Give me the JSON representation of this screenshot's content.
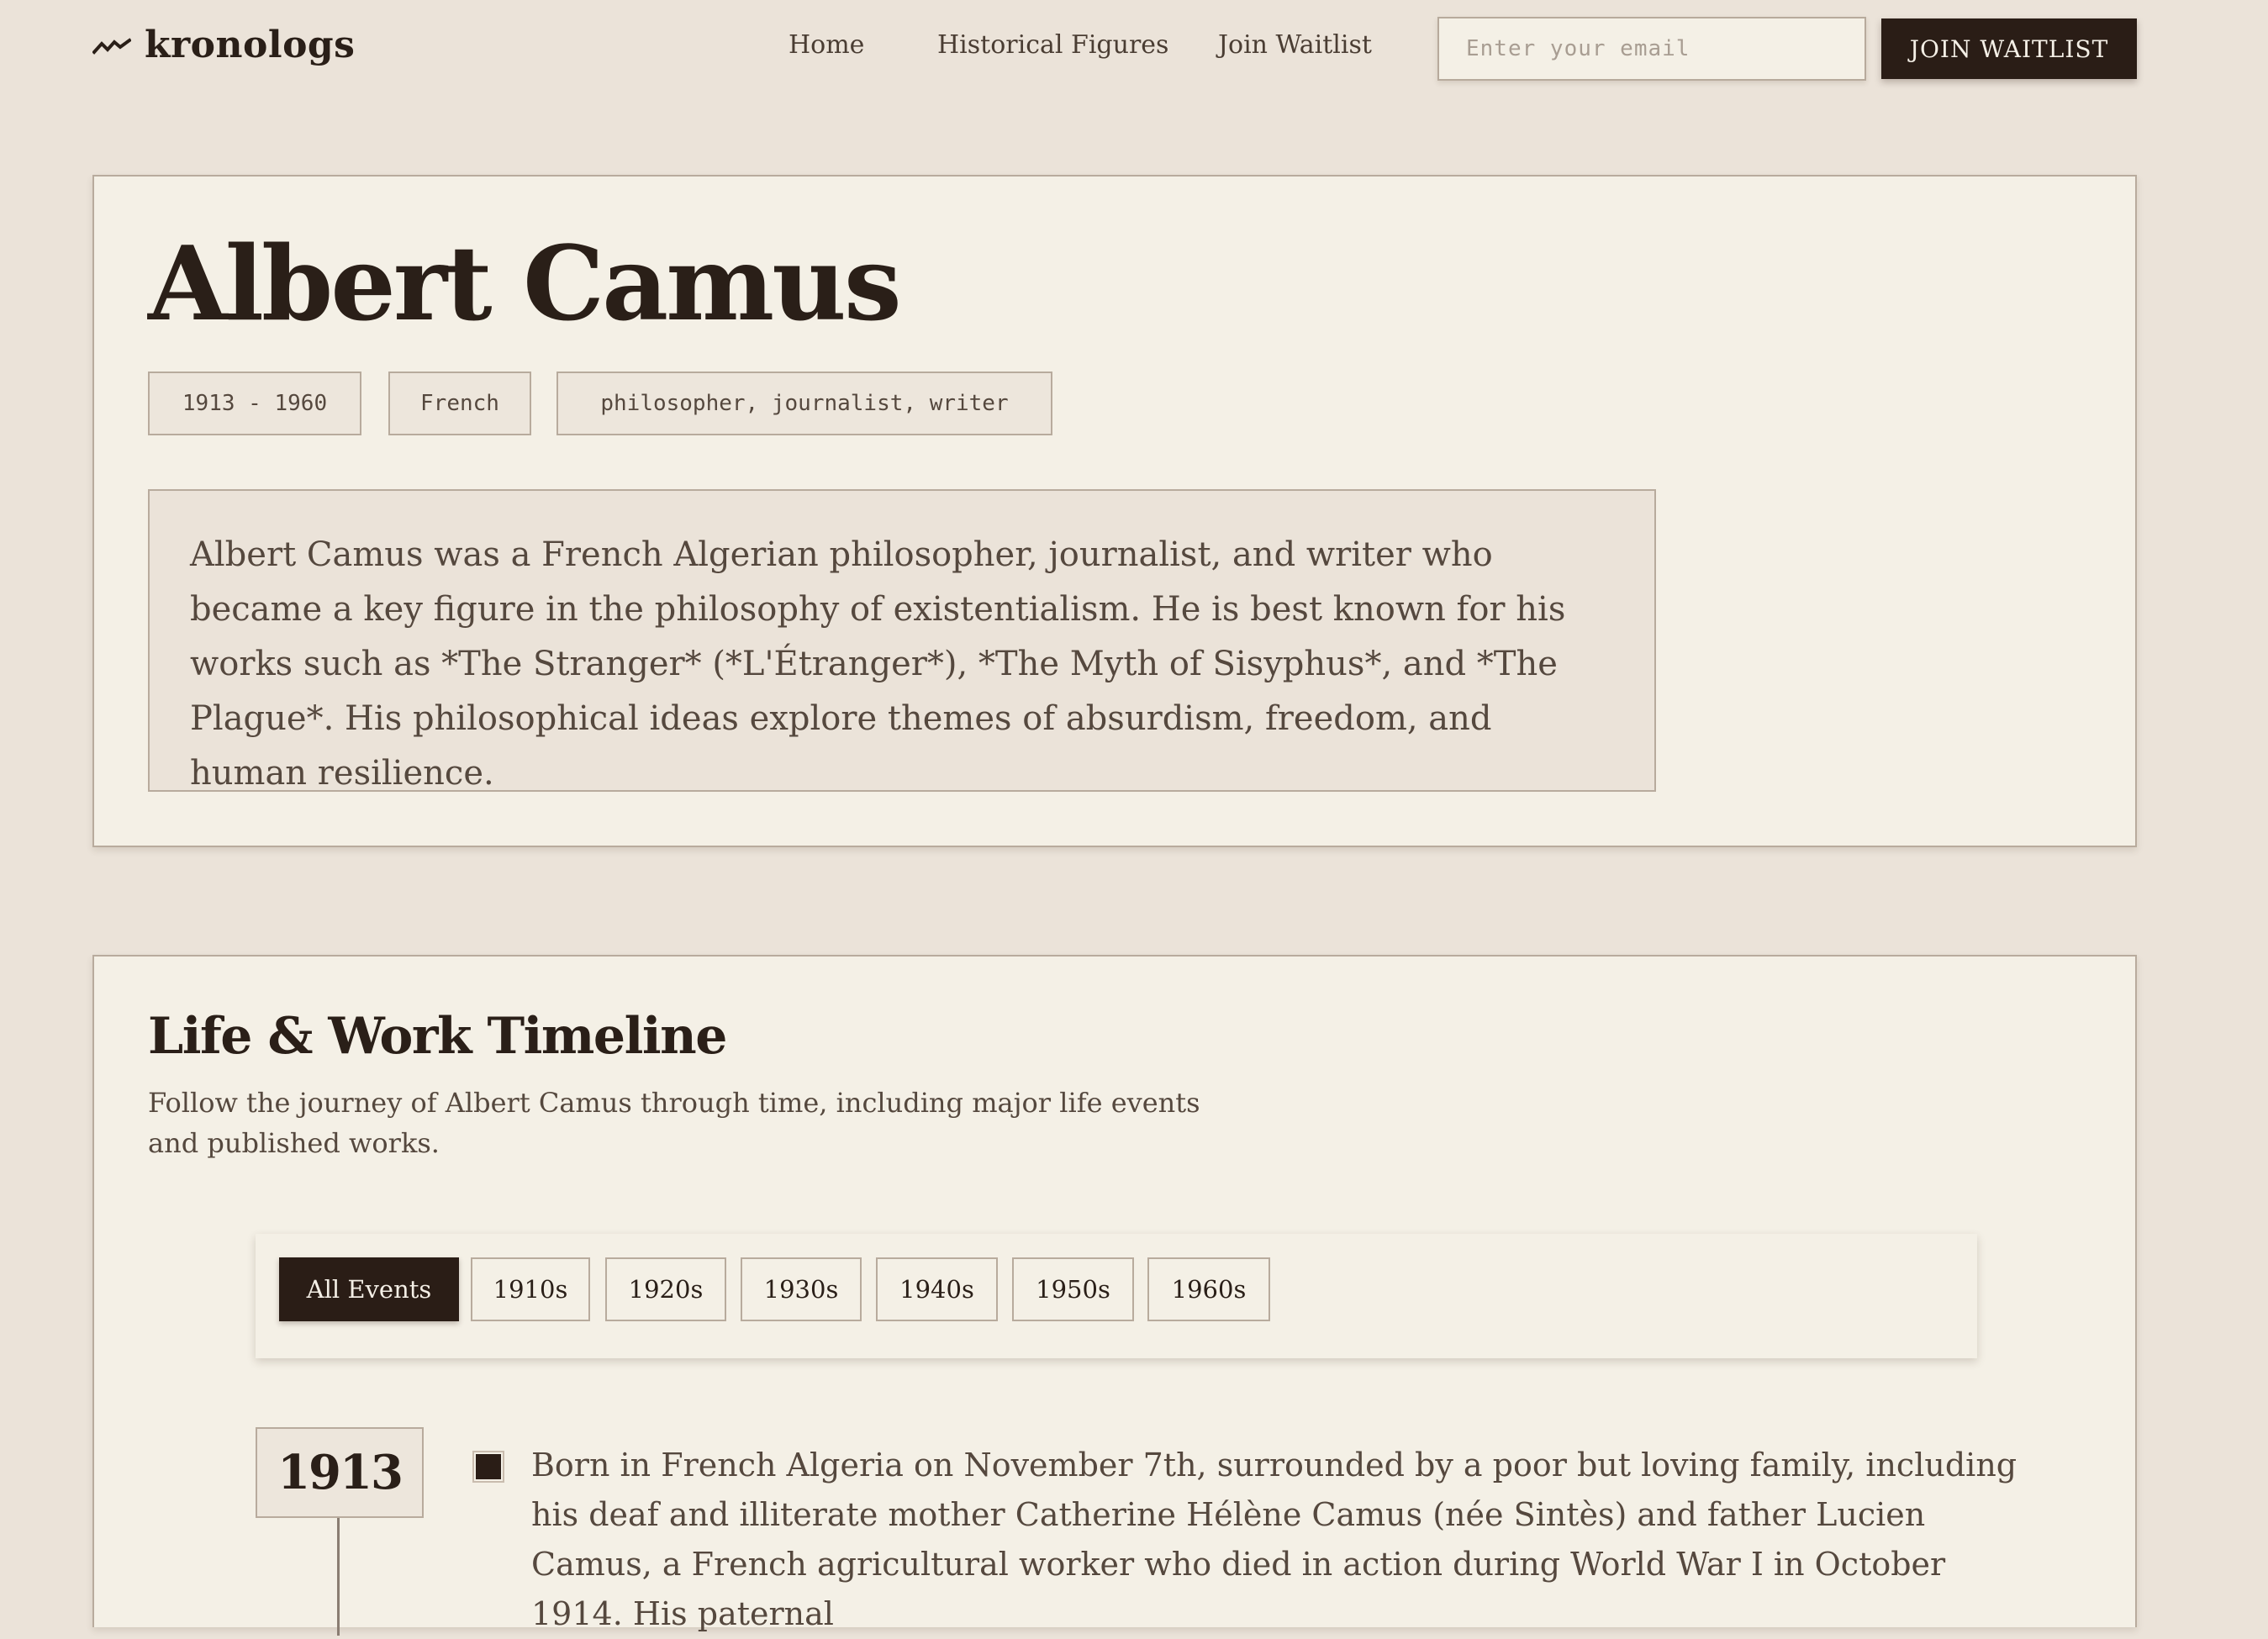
{
  "header": {
    "logo_text": "kronologs",
    "nav": [
      {
        "label": "Home"
      },
      {
        "label": "Historical Figures"
      },
      {
        "label": "Join Waitlist"
      }
    ],
    "email_placeholder": "Enter your email",
    "join_button_label": "JOIN WAITLIST"
  },
  "profile": {
    "name": "Albert Camus",
    "tags": [
      "1913 - 1960",
      "French",
      "philosopher, journalist, writer"
    ],
    "bio": "Albert Camus was a French Algerian philosopher, journalist, and writer who became a key figure in the philosophy of existentialism. He is best known for his works such as *The Stranger* (*L'Étranger*), *The Myth of Sisyphus*, and *The Plague*. His philosophical ideas explore themes of absurdism, freedom, and human resilience."
  },
  "timeline": {
    "title": "Life & Work Timeline",
    "description": "Follow the journey of Albert Camus through time, including major life events and published works.",
    "filters": [
      {
        "label": "All Events",
        "active": true
      },
      {
        "label": "1910s",
        "active": false
      },
      {
        "label": "1920s",
        "active": false
      },
      {
        "label": "1930s",
        "active": false
      },
      {
        "label": "1940s",
        "active": false
      },
      {
        "label": "1950s",
        "active": false
      },
      {
        "label": "1960s",
        "active": false
      }
    ],
    "events": [
      {
        "year": "1913",
        "text": "Born in French Algeria on November 7th, surrounded by a poor but loving family, including his deaf and illiterate mother Catherine Hélène Camus (née Sintès) and father Lucien Camus, a French agricultural worker who died in action during World War I in October 1914. His paternal"
      }
    ]
  },
  "colors": {
    "background": "#ebe3d9",
    "card": "#f4f0e6",
    "border": "#b8ab9d",
    "ink": "#2a1f18",
    "muted_text": "#55483e",
    "dark_button": "#2a1d16"
  }
}
